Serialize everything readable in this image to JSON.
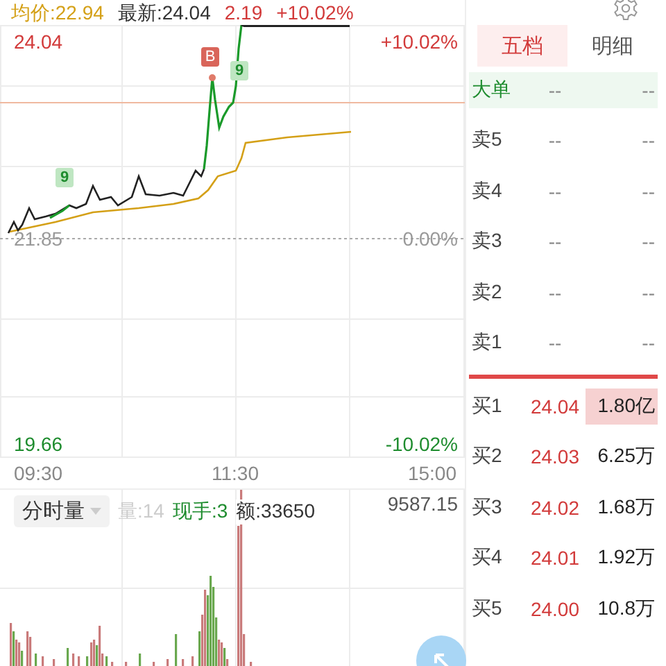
{
  "header": {
    "average": "均价:22.94",
    "latest": "最新:24.04",
    "change": "2.19",
    "change_pct": "+10.02%"
  },
  "price_chart": {
    "labels": [
      {
        "text": "24.04",
        "kind": "up"
      },
      {
        "text": "+10.02%",
        "kind": "up"
      },
      {
        "text": "21.85",
        "kind": "flat"
      },
      {
        "text": "0.00%",
        "kind": "flat"
      },
      {
        "text": "19.66",
        "kind": "down"
      },
      {
        "text": "-10.02%",
        "kind": "down"
      }
    ],
    "markers": [
      {
        "text": "9",
        "kind": "nine"
      },
      {
        "text": "B",
        "kind": "buy"
      },
      {
        "text": "9",
        "kind": "nine"
      }
    ]
  },
  "time_axis": [
    "09:30",
    "11:30",
    "15:00"
  ],
  "volume": {
    "selector": "分时量",
    "volume": "量:14",
    "hand": "现手:3",
    "amount": "额:33650",
    "max": "9587.15"
  },
  "order_book": {
    "tabs": [
      {
        "label": "五档",
        "selected": true
      },
      {
        "label": "明细",
        "selected": false
      }
    ],
    "rows": [
      {
        "kind": "big",
        "label": "大单",
        "price": "--",
        "volume": "--",
        "highlighted": false
      },
      {
        "kind": "ask",
        "label": "卖5",
        "price": "--",
        "volume": "--",
        "highlighted": false
      },
      {
        "kind": "ask",
        "label": "卖4",
        "price": "--",
        "volume": "--",
        "highlighted": false
      },
      {
        "kind": "ask",
        "label": "卖3",
        "price": "--",
        "volume": "--",
        "highlighted": false
      },
      {
        "kind": "ask",
        "label": "卖2",
        "price": "--",
        "volume": "--",
        "highlighted": false
      },
      {
        "kind": "ask",
        "label": "卖1",
        "price": "--",
        "volume": "--",
        "highlighted": false
      },
      {
        "kind": "bid",
        "label": "买1",
        "price": "24.04",
        "volume": "1.80亿",
        "highlighted": true
      },
      {
        "kind": "bid",
        "label": "买2",
        "price": "24.03",
        "volume": "6.25万",
        "highlighted": false
      },
      {
        "kind": "bid",
        "label": "买3",
        "price": "24.02",
        "volume": "1.68万",
        "highlighted": false
      },
      {
        "kind": "bid",
        "label": "买4",
        "price": "24.01",
        "volume": "1.92万",
        "highlighted": false
      },
      {
        "kind": "bid",
        "label": "买5",
        "price": "24.00",
        "volume": "10.8万",
        "highlighted": false
      }
    ]
  }
}
